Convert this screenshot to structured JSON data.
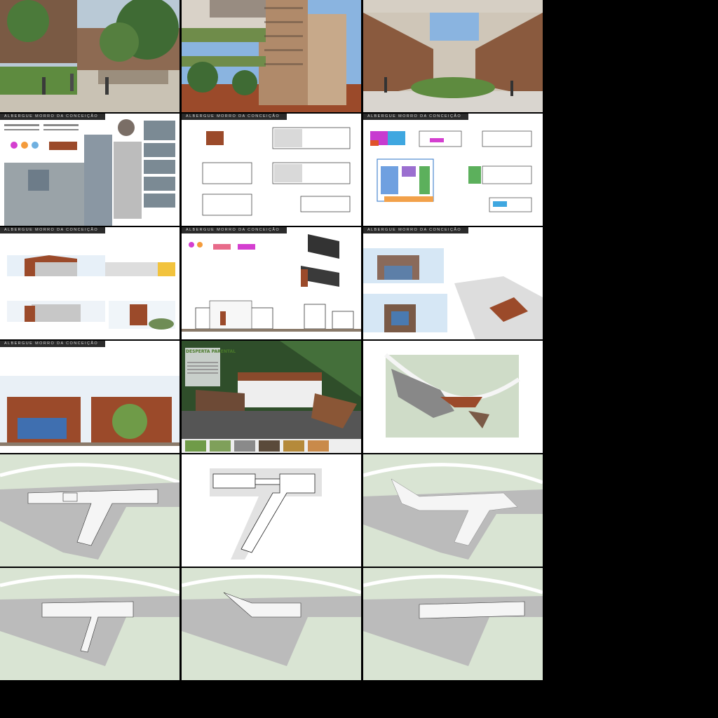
{
  "sheet_header": "ALBERGUE MORRO DA CONCEIÇÃO",
  "poster_title": "DESPERTA PARENTAL",
  "colors": {
    "background": "#000000",
    "header_bar": "#2b2b2b",
    "brick": "#9b4a2a",
    "landscape": "#cfdcc8",
    "sky": "#8ab4e0"
  }
}
